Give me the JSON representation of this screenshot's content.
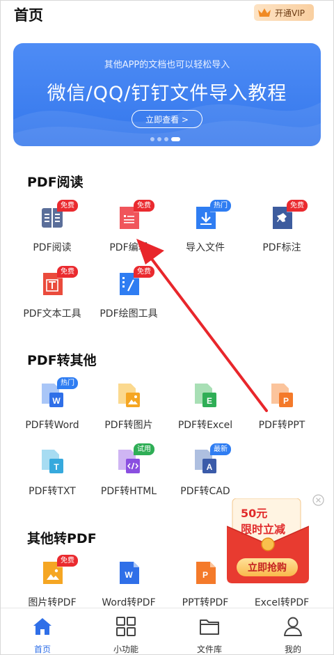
{
  "header": {
    "title": "首页",
    "vip_label": "开通VIP"
  },
  "banner": {
    "subtitle": "其他APP的文档也可以轻松导入",
    "title": "微信/QQ/钉钉文件导入教程",
    "button": "立即查看 >"
  },
  "sections": {
    "pdf_read": {
      "title": "PDF阅读",
      "items": [
        {
          "name": "PDF阅读",
          "badge": "免费"
        },
        {
          "name": "PDF编辑",
          "badge": "免费"
        },
        {
          "name": "导入文件",
          "badge": "热门"
        },
        {
          "name": "PDF标注",
          "badge": "免费"
        },
        {
          "name": "PDF文本工具",
          "badge": "免费"
        },
        {
          "name": "PDF绘图工具",
          "badge": "免费"
        }
      ]
    },
    "pdf_to_other": {
      "title": "PDF转其他",
      "items": [
        {
          "name": "PDF转Word",
          "badge": "热门",
          "letter": "W"
        },
        {
          "name": "PDF转图片"
        },
        {
          "name": "PDF转Excel",
          "letter": "E"
        },
        {
          "name": "PDF转PPT",
          "letter": "P"
        },
        {
          "name": "PDF转TXT",
          "letter": "T"
        },
        {
          "name": "PDF转HTML",
          "badge": "试用"
        },
        {
          "name": "PDF转CAD",
          "badge": "最新",
          "letter": "A"
        }
      ]
    },
    "other_to_pdf": {
      "title": "其他转PDF",
      "items": [
        {
          "name": "图片转PDF",
          "badge": "免费"
        },
        {
          "name": "Word转PDF",
          "letter": "W"
        },
        {
          "name": "PPT转PDF",
          "letter": "P"
        },
        {
          "name": "Excel转PDF"
        }
      ]
    }
  },
  "promo": {
    "amount": "50元",
    "desc": "限时立减",
    "button": "立即抢购"
  },
  "nav": [
    {
      "label": "首页"
    },
    {
      "label": "小功能"
    },
    {
      "label": "文件库"
    },
    {
      "label": "我的"
    }
  ],
  "colors": {
    "accent": "#2f6fe8",
    "badge_red": "#ea2a2f",
    "badge_blue": "#2f7df2",
    "badge_green": "#2fae56",
    "arrow": "#e8262b"
  }
}
